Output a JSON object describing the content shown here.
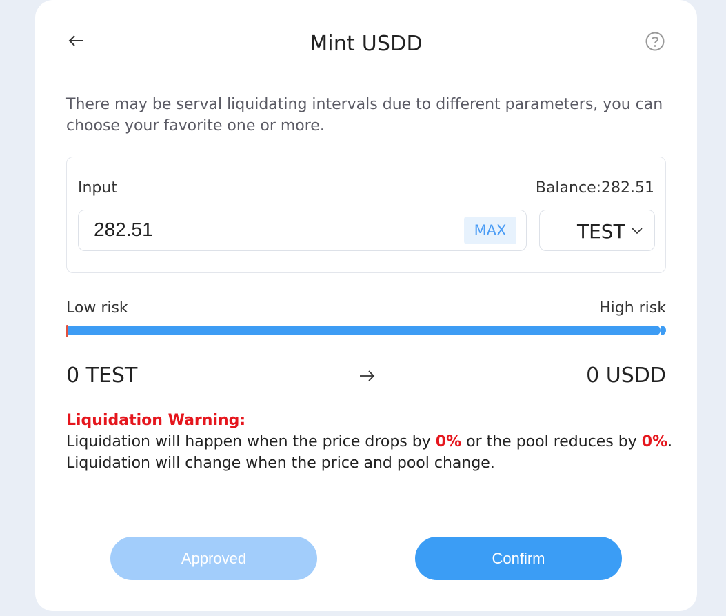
{
  "header": {
    "title": "Mint USDD"
  },
  "description": "There may be serval liquidating intervals due to different parameters, you can choose your favorite one or more.",
  "input": {
    "label": "Input",
    "balance": "Balance:282.51",
    "value": "282.51",
    "max_label": "MAX",
    "token": "TEST"
  },
  "risk": {
    "low_label": "Low risk",
    "high_label": "High risk",
    "level": 1.0
  },
  "conversion": {
    "from": "0 TEST",
    "to": "0 USDD"
  },
  "warning": {
    "title": "Liquidation Warning:",
    "line1_a": "Liquidation will happen when the price drops by ",
    "price_drop": "0%",
    "line1_b": " or the pool reduces by ",
    "pool_reduce": "0%",
    "line1_c": ".",
    "line2": "Liquidation will change when the price and pool change."
  },
  "buttons": {
    "approved": "Approved",
    "confirm": "Confirm"
  },
  "colors": {
    "accent": "#3b9df5",
    "accent_disabled": "#a2cdfb",
    "warning": "#e5161d"
  }
}
